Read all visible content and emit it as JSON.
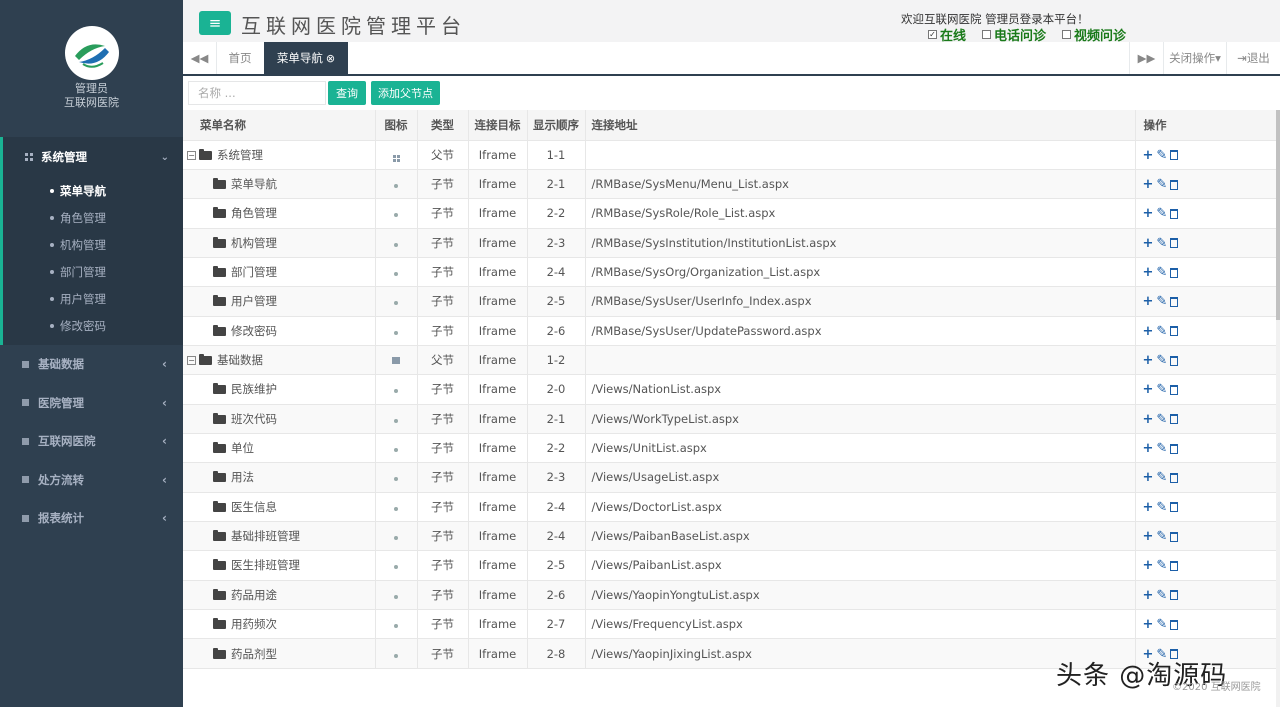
{
  "sidebar": {
    "profile_role": "管理员",
    "profile_org": "互联网医院",
    "active_section": "系统管理",
    "sub_items": [
      "菜单导航",
      "角色管理",
      "机构管理",
      "部门管理",
      "用户管理",
      "修改密码"
    ],
    "sections": [
      "基础数据",
      "医院管理",
      "互联网医院",
      "处方流转",
      "报表统计"
    ]
  },
  "header": {
    "title": "互联网医院管理平台",
    "welcome": "欢迎互联网医院 管理员登录本平台！",
    "statuses": [
      {
        "label": "在线",
        "checked": true
      },
      {
        "label": "电话问诊",
        "checked": false
      },
      {
        "label": "视频问诊",
        "checked": false
      }
    ]
  },
  "tabs": {
    "home": "首页",
    "active": "菜单导航",
    "close_ops": "关闭操作",
    "logout": "退出"
  },
  "toolbar": {
    "search_placeholder": "名称 ...",
    "query_label": "查询",
    "add_parent_label": "添加父节点"
  },
  "table": {
    "columns": [
      "菜单名称",
      "图标",
      "类型",
      "连接目标",
      "显示顺序",
      "连接地址",
      "操作"
    ],
    "rows": [
      {
        "name": "系统管理",
        "level": 0,
        "icon": "grid",
        "type": "父节",
        "target": "Iframe",
        "order": "1-1",
        "url": ""
      },
      {
        "name": "菜单导航",
        "level": 1,
        "icon": "dot",
        "type": "子节",
        "target": "Iframe",
        "order": "2-1",
        "url": "/RMBase/SysMenu/Menu_List.aspx"
      },
      {
        "name": "角色管理",
        "level": 1,
        "icon": "dot",
        "type": "子节",
        "target": "Iframe",
        "order": "2-2",
        "url": "/RMBase/SysRole/Role_List.aspx"
      },
      {
        "name": "机构管理",
        "level": 1,
        "icon": "dot",
        "type": "子节",
        "target": "Iframe",
        "order": "2-3",
        "url": "/RMBase/SysInstitution/InstitutionList.aspx"
      },
      {
        "name": "部门管理",
        "level": 1,
        "icon": "dot",
        "type": "子节",
        "target": "Iframe",
        "order": "2-4",
        "url": "/RMBase/SysOrg/Organization_List.aspx"
      },
      {
        "name": "用户管理",
        "level": 1,
        "icon": "dot",
        "type": "子节",
        "target": "Iframe",
        "order": "2-5",
        "url": "/RMBase/SysUser/UserInfo_Index.aspx"
      },
      {
        "name": "修改密码",
        "level": 1,
        "icon": "dot",
        "type": "子节",
        "target": "Iframe",
        "order": "2-6",
        "url": "/RMBase/SysUser/UpdatePassword.aspx"
      },
      {
        "name": "基础数据",
        "level": 0,
        "icon": "square",
        "type": "父节",
        "target": "Iframe",
        "order": "1-2",
        "url": ""
      },
      {
        "name": "民族维护",
        "level": 1,
        "icon": "dot",
        "type": "子节",
        "target": "Iframe",
        "order": "2-0",
        "url": "/Views/NationList.aspx"
      },
      {
        "name": "班次代码",
        "level": 1,
        "icon": "dot",
        "type": "子节",
        "target": "Iframe",
        "order": "2-1",
        "url": "/Views/WorkTypeList.aspx"
      },
      {
        "name": "单位",
        "level": 1,
        "icon": "dot",
        "type": "子节",
        "target": "Iframe",
        "order": "2-2",
        "url": "/Views/UnitList.aspx"
      },
      {
        "name": "用法",
        "level": 1,
        "icon": "dot",
        "type": "子节",
        "target": "Iframe",
        "order": "2-3",
        "url": "/Views/UsageList.aspx"
      },
      {
        "name": "医生信息",
        "level": 1,
        "icon": "dot",
        "type": "子节",
        "target": "Iframe",
        "order": "2-4",
        "url": "/Views/DoctorList.aspx"
      },
      {
        "name": "基础排班管理",
        "level": 1,
        "icon": "dot",
        "type": "子节",
        "target": "Iframe",
        "order": "2-4",
        "url": "/Views/PaibanBaseList.aspx"
      },
      {
        "name": "医生排班管理",
        "level": 1,
        "icon": "dot",
        "type": "子节",
        "target": "Iframe",
        "order": "2-5",
        "url": "/Views/PaibanList.aspx"
      },
      {
        "name": "药品用途",
        "level": 1,
        "icon": "dot",
        "type": "子节",
        "target": "Iframe",
        "order": "2-6",
        "url": "/Views/YaopinYongtuList.aspx"
      },
      {
        "name": "用药频次",
        "level": 1,
        "icon": "dot",
        "type": "子节",
        "target": "Iframe",
        "order": "2-7",
        "url": "/Views/FrequencyList.aspx"
      },
      {
        "name": "药品剂型",
        "level": 1,
        "icon": "dot",
        "type": "子节",
        "target": "Iframe",
        "order": "2-8",
        "url": "/Views/YaopinJixingList.aspx"
      }
    ]
  },
  "footer": {
    "watermark": "头条 @淘源码",
    "copyright": "©2020 互联网医院"
  },
  "colors": {
    "sidebar": "#2f4050",
    "accent": "#1ab394",
    "action": "#1c5fa8"
  }
}
